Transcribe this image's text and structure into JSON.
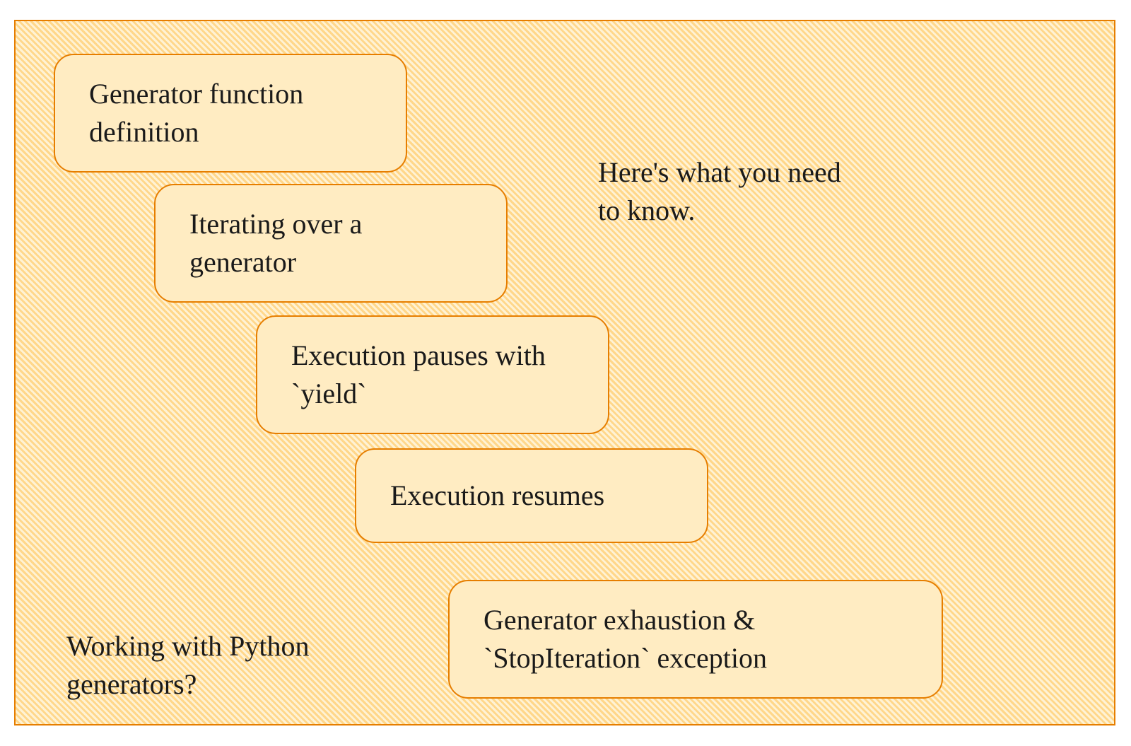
{
  "diagram": {
    "cards": [
      {
        "text": "Generator function definition"
      },
      {
        "text": "Iterating over a generator"
      },
      {
        "text": "Execution pauses with `yield`"
      },
      {
        "text": "Execution resumes"
      },
      {
        "text": "Generator exhaustion & `StopIteration` exception"
      }
    ],
    "notes": {
      "intro": "Working with Python\n generators?",
      "hint": "Here's what you need\nto know."
    }
  }
}
